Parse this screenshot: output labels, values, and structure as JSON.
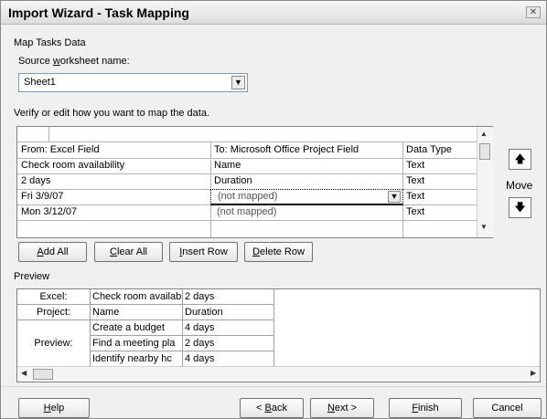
{
  "window": {
    "title": "Import Wizard - Task Mapping",
    "close_glyph": "✕"
  },
  "section": {
    "title": "Map Tasks Data"
  },
  "source": {
    "label_before": "Source ",
    "label_accel": "w",
    "label_after": "orksheet name:",
    "value": "Sheet1"
  },
  "instructions": "Verify or edit how you want to map the data.",
  "mapping": {
    "headers": [
      "From: Excel Field",
      "To:  Microsoft Office Project Field",
      "Data Type"
    ],
    "rows": [
      {
        "from": "Check room availability",
        "to": "Name",
        "type": "Text"
      },
      {
        "from": "2 days",
        "to": "Duration",
        "type": "Text"
      },
      {
        "from": "Fri 3/9/07",
        "to": "(not mapped)",
        "type": "Text"
      },
      {
        "from": "Mon 3/12/07",
        "to": "(not mapped)",
        "type": "Text"
      }
    ]
  },
  "move": {
    "label": "Move",
    "up_glyph": "🡅",
    "down_glyph": "🡇"
  },
  "buttons": {
    "add_all": {
      "accel": "A",
      "rest": "dd All"
    },
    "clear_all": {
      "accel": "C",
      "rest": "lear All"
    },
    "insert_row": {
      "accel": "I",
      "rest": "nsert Row"
    },
    "delete_row": {
      "accel": "D",
      "rest": "elete Row"
    }
  },
  "preview": {
    "label": "Preview",
    "row_labels": [
      "Excel:",
      "Project:",
      "Preview:"
    ],
    "excel": [
      "Check room availab",
      "2 days"
    ],
    "project": [
      "Name",
      "Duration"
    ],
    "rows": [
      [
        "Create a budget",
        "4 days"
      ],
      [
        "Find a meeting pla",
        "2 days"
      ],
      [
        "Identify nearby hc",
        "4 days"
      ]
    ]
  },
  "footer": {
    "help": {
      "accel": "H",
      "rest": "elp"
    },
    "back": {
      "before": "< ",
      "accel": "B",
      "rest": "ack"
    },
    "next": {
      "accel": "N",
      "rest": "ext >"
    },
    "finish": {
      "accel": "F",
      "rest": "inish"
    },
    "cancel": "Cancel"
  }
}
